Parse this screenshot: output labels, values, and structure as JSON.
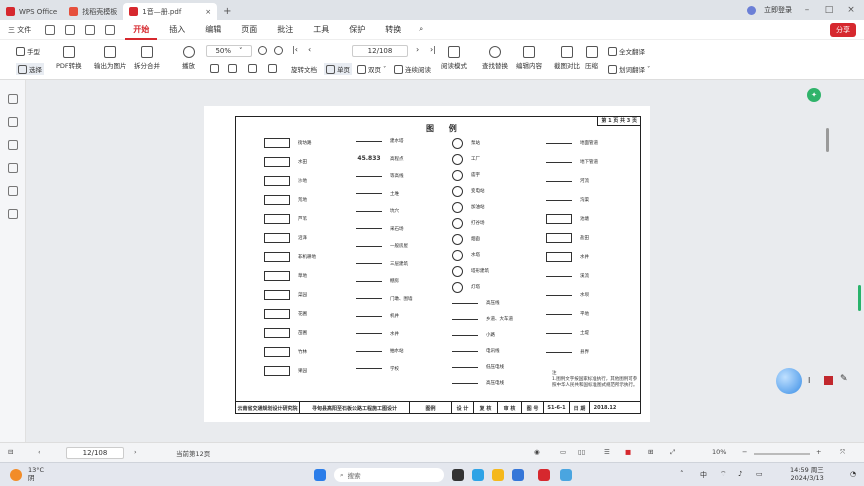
{
  "tabs": [
    {
      "label": "WPS Office",
      "color": "#d6282e"
    },
    {
      "label": "找稻壳模板",
      "color": "#e6503c"
    },
    {
      "label": "1音—册.pdf",
      "color": "#d6282e"
    }
  ],
  "tab_add": "+",
  "account": "立即登录",
  "menubar": {
    "file": "三 文件",
    "items": [
      "开始",
      "插入",
      "编辑",
      "页面",
      "批注",
      "工具",
      "保护",
      "转换"
    ],
    "active": "开始",
    "share": "分享"
  },
  "ribbon": {
    "hand": "手型",
    "select": "选择",
    "pdf_convert": "PDF转换",
    "export_image": "输出为图片",
    "split_merge": "拆分合并",
    "play": "播放",
    "zoom": "50%",
    "page": "12/108",
    "rotate": "旋转文档",
    "single": "单页",
    "double": "双页",
    "continuous": "连续阅读",
    "read_mode": "阅读模式",
    "find": "查找替换",
    "edit_content": "编辑内容",
    "screenshot_compare": "截图对比",
    "compress": "压缩",
    "translate_full": "全文翻译",
    "translate_word": "划词翻译"
  },
  "document": {
    "title": "图 例",
    "sheet_no": "第 1 页 共 3 页",
    "col1": [
      "街坊路",
      "水田",
      "沙地",
      "荒地",
      "芦苇",
      "沼泽",
      "非机耕地",
      "草地",
      "菜园",
      "花圃",
      "苗圃",
      "竹林",
      "果园"
    ],
    "col2": [
      "建水塔",
      "高程点",
      "等高线",
      "土堆",
      "坑穴",
      "采石场",
      "一般房屋",
      "三层建筑",
      "棚房",
      "门墩、围墙",
      "机井",
      "水井",
      "抽水站",
      "学校"
    ],
    "col3": [
      "泵站",
      "工厂",
      "庙宇",
      "变电站",
      "加油站",
      "打谷场",
      "烟囱",
      "水塔",
      "塔形建筑",
      "灯塔",
      "高压线",
      "乡道、大车道",
      "小路",
      "电讯线",
      "低压电线",
      "高压电线"
    ],
    "col4": [
      "地面管道",
      "地下管道",
      "河流",
      "沟渠",
      "池塘",
      "盐田",
      "水井",
      "溪流",
      "水坝",
      "平地",
      "土堤",
      "县界"
    ],
    "elevation": "45.833",
    "note_title": "注",
    "note_body": "1.图例文字按国家标准执行，其他图例可参照中华人民共和国标准图式规范所示执行。",
    "footer": [
      "云南省交通规划设计研究院",
      "寻甸县高阳至石板公路工程施工图设计",
      "图例",
      "设 计",
      "复 核",
      "审 核",
      "图 号",
      "S1-6-1",
      "日 期",
      "2018.12"
    ]
  },
  "statusbar": {
    "page": "12/108",
    "page_label": "当前第12页",
    "zoom": "10%"
  },
  "taskbar": {
    "weather_temp": "13°C",
    "weather_desc": "阴",
    "search_placeholder": "搜索",
    "time": "14:59 周三",
    "date": "2024/3/13"
  }
}
